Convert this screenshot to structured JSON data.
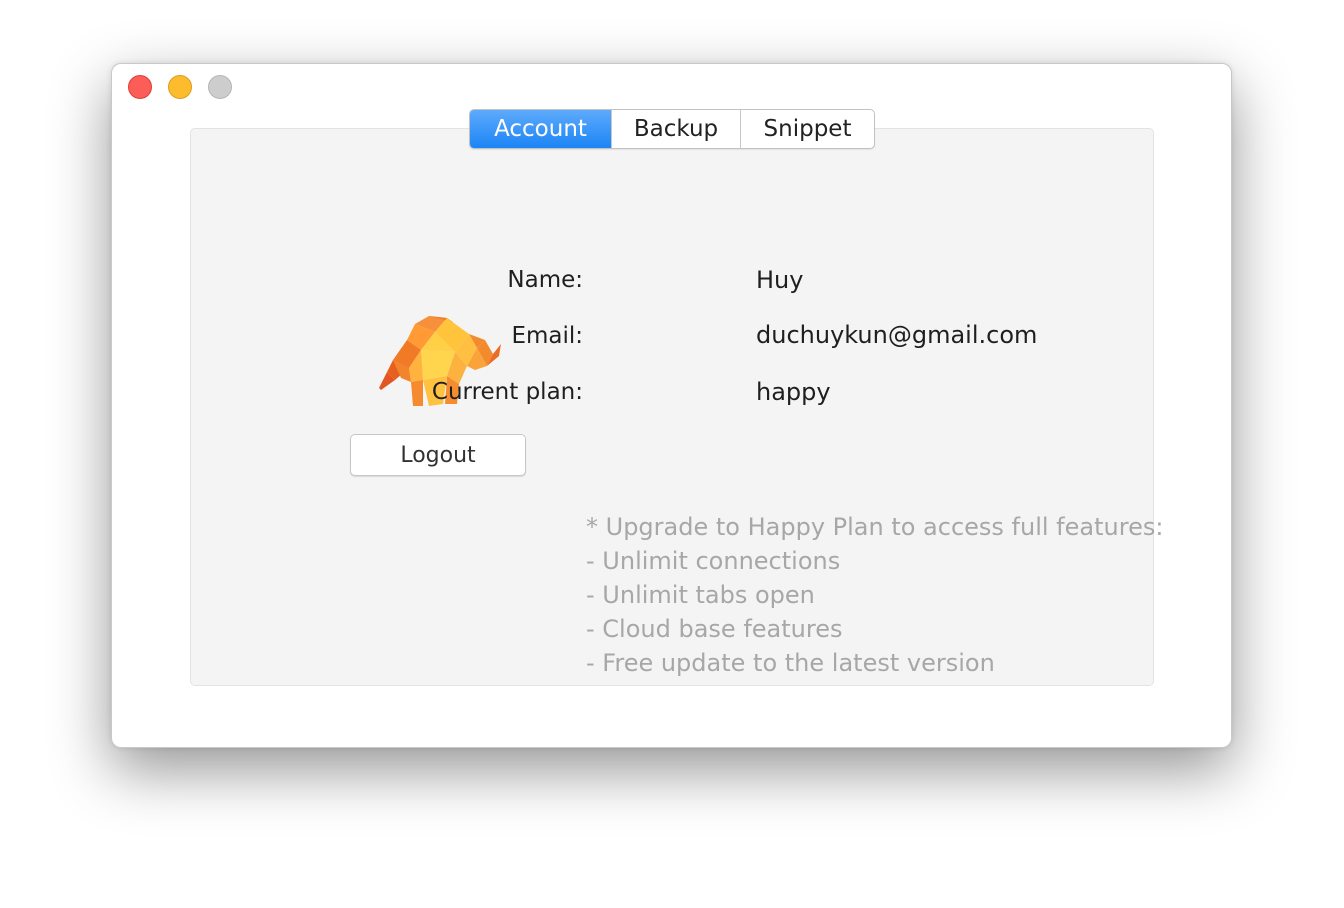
{
  "window": {
    "controls": [
      "close",
      "minimize",
      "zoom"
    ]
  },
  "tabs": [
    {
      "label": "Account",
      "selected": true
    },
    {
      "label": "Backup",
      "selected": false
    },
    {
      "label": "Snippet",
      "selected": false
    }
  ],
  "account": {
    "logo_icon": "tableplus-elephant-logo-icon",
    "logout_label": "Logout",
    "name_label": "Name:",
    "name_value": "Huy",
    "email_label": "Email:",
    "email_value": "duchuykun@gmail.com",
    "plan_label": "Current plan:",
    "plan_value": "happy",
    "upgrade_notes": [
      "* Upgrade to Happy Plan to access full features:",
      "- Unlimit connections",
      "- Unlimit tabs open",
      "- Cloud base features",
      "- Free update to the latest version"
    ]
  },
  "colors": {
    "accent": "#1c85f6",
    "muted_text": "#a7a7a7"
  }
}
